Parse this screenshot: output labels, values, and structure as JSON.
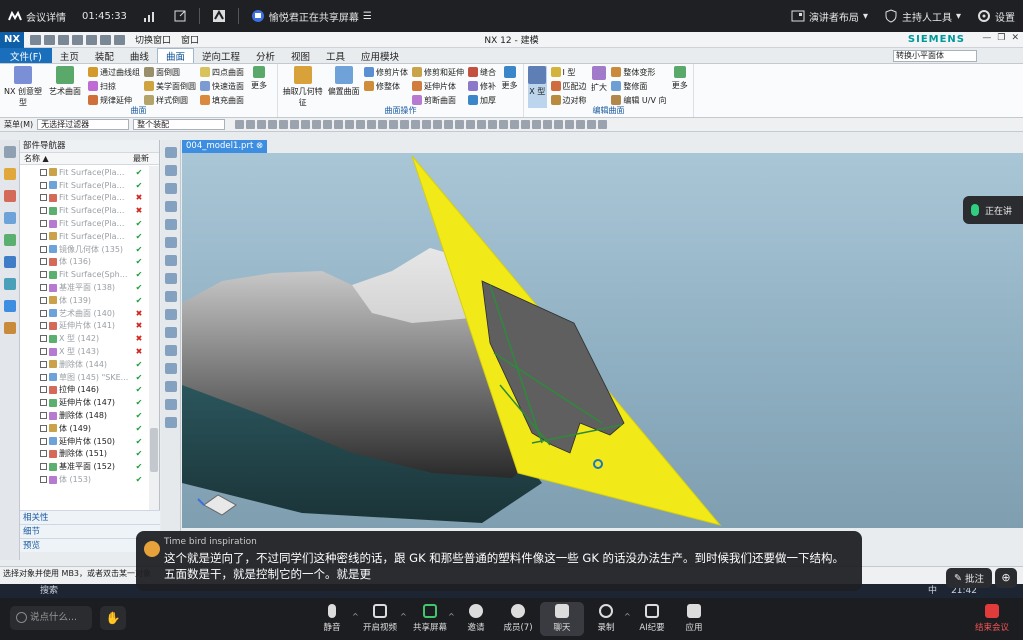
{
  "meeting_top": {
    "meeting_details": "会议详情",
    "elapsed": "01:45:33",
    "sharing_text": "愉悦君正在共享屏幕",
    "presenter_layout": "演讲者布局",
    "host_tools": "主持人工具",
    "settings": "设置"
  },
  "nx": {
    "logo": "NX",
    "quick_cmds": [
      "切换窗口",
      "窗口"
    ],
    "window_title": "NX 12 - 建模",
    "brand": "SIEMENS",
    "menu": {
      "file": "文件(F)",
      "tabs": [
        "主页",
        "装配",
        "曲线",
        "曲面",
        "逆向工程",
        "分析",
        "视图",
        "工具",
        "应用模块"
      ],
      "active_tab": "曲面",
      "command_search": "转换小平面体"
    },
    "ribbon": {
      "group1": {
        "big": [
          "NX 创意塑型",
          "艺术曲面"
        ],
        "small": [
          "通过曲线组",
          "扫掠",
          "规律延伸",
          "面倒圆",
          "美学面倒圆",
          "样式倒圆",
          "四点曲面",
          "快速造面",
          "填充曲面"
        ],
        "more": "更多",
        "caption": "曲面"
      },
      "group2": {
        "big": [
          "抽取几何特征",
          "偏置曲面"
        ],
        "small": [
          "修剪片体",
          "修整体",
          "修剪和延伸",
          "延伸片体",
          "剪断曲面",
          "缝合",
          "修补",
          "加厚"
        ],
        "more": "更多",
        "caption": "曲面操作"
      },
      "group3": {
        "big": [
          "X 型"
        ],
        "small": [
          "I 型",
          "匹配边",
          "边对称",
          "扩大",
          "整体变形",
          "整修面",
          "编辑 U/V 向"
        ],
        "more": "更多",
        "caption": "编辑曲面"
      }
    },
    "selbar": {
      "menu": "菜单(M)",
      "filter": "无选择过滤器",
      "scope": "整个装配"
    },
    "part_navigator": {
      "title": "部件导航器",
      "col_name": "名称",
      "col_latest": "最新",
      "rows": [
        {
          "label": "Fit Surface(Plan...",
          "dim": true,
          "status": "ok"
        },
        {
          "label": "Fit Surface(Plan...",
          "dim": true,
          "status": "ok"
        },
        {
          "label": "Fit Surface(Plan...",
          "dim": true,
          "status": "bad"
        },
        {
          "label": "Fit Surface(Plan...",
          "dim": true,
          "status": "bad"
        },
        {
          "label": "Fit Surface(Plan...",
          "dim": true,
          "status": "ok"
        },
        {
          "label": "Fit Surface(Plan...",
          "dim": true,
          "status": "ok"
        },
        {
          "label": "镜像几何体 (135)",
          "dim": true,
          "status": "ok"
        },
        {
          "label": "体 (136)",
          "dim": true,
          "status": "ok"
        },
        {
          "label": "Fit Surface(Sph...",
          "dim": true,
          "status": "ok"
        },
        {
          "label": "基准平面 (138)",
          "dim": true,
          "status": "ok"
        },
        {
          "label": "体 (139)",
          "dim": true,
          "status": "ok"
        },
        {
          "label": "艺术曲面 (140)",
          "dim": true,
          "status": "bad"
        },
        {
          "label": "延伸片体 (141)",
          "dim": true,
          "status": "bad"
        },
        {
          "label": "X 型 (142)",
          "dim": true,
          "status": "bad"
        },
        {
          "label": "X 型 (143)",
          "dim": true,
          "status": "bad"
        },
        {
          "label": "删除体 (144)",
          "dim": true,
          "status": "ok"
        },
        {
          "label": "草图 (145) \"SKE...",
          "dim": true,
          "status": "ok"
        },
        {
          "label": "拉伸 (146)",
          "dim": false,
          "status": "ok"
        },
        {
          "label": "延伸片体 (147)",
          "dim": false,
          "status": "ok"
        },
        {
          "label": "删除体 (148)",
          "dim": false,
          "status": "ok"
        },
        {
          "label": "体 (149)",
          "dim": false,
          "status": "ok"
        },
        {
          "label": "延伸片体 (150)",
          "dim": false,
          "status": "ok"
        },
        {
          "label": "删除体 (151)",
          "dim": false,
          "status": "ok"
        },
        {
          "label": "基准平面 (152)",
          "dim": false,
          "status": "ok"
        },
        {
          "label": "体 (153)",
          "dim": true,
          "status": "ok"
        }
      ],
      "sections": [
        "相关性",
        "细节",
        "预览"
      ]
    },
    "doc_tab": "004_model1.prt",
    "status_line": "选择对象并使用 MB3，或者双击某一对象"
  },
  "speaking_label": "正在讲",
  "subtitle": {
    "speaker": "Time bird inspiration",
    "text": "这个就是逆向了，不过同学们这种密线的话，跟 GK 和那些普通的塑料件像这一些 GK 的话没办法生产。到时候我们还要做一下结构。五面数是干，就是控制它的一个。就是更"
  },
  "annotate_label": "批注",
  "taskbar": {
    "search": "搜索",
    "ime": "中",
    "time": "21:42"
  },
  "meeting_bottom": {
    "input_placeholder": "说点什么...",
    "buttons": [
      {
        "key": "mute",
        "label": "静音"
      },
      {
        "key": "video",
        "label": "开启视频"
      },
      {
        "key": "share",
        "label": "共享屏幕"
      },
      {
        "key": "invite",
        "label": "邀请"
      },
      {
        "key": "members",
        "label": "成员(7)"
      },
      {
        "key": "chat",
        "label": "聊天"
      },
      {
        "key": "record",
        "label": "录制"
      },
      {
        "key": "ai",
        "label": "AI纪要"
      },
      {
        "key": "apps",
        "label": "应用"
      }
    ],
    "end": "结束会议"
  },
  "colors": {
    "accent": "#1a6fbd",
    "yellow_face": "#f2ea18",
    "ok": "#1d9e3a",
    "bad": "#d4231b",
    "end": "#e23b3b"
  }
}
